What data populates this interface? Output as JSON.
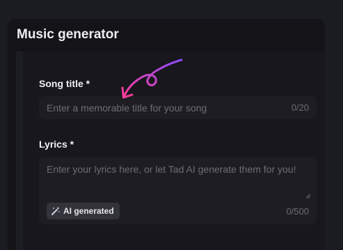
{
  "panel": {
    "title": "Music generator"
  },
  "song_title": {
    "label": "Song title *",
    "value": "",
    "placeholder": "Enter a memorable title for your song",
    "counter": "0/20"
  },
  "lyrics": {
    "label": "Lyrics *",
    "value": "",
    "placeholder": "Enter your lyrics here, or let Tad AI generate them for you!",
    "counter": "0/500",
    "ai_button_label": "AI generated",
    "ai_button_icon": "magic-wand-icon"
  },
  "decoration": {
    "arrow_icon": "curly-arrow-icon",
    "arrow_colors": [
      "#8a4dff",
      "#ff3d9a"
    ]
  },
  "colors": {
    "background": "#1b1b22",
    "panel": "#131318",
    "input": "#1d1d23",
    "badge": "#33333b"
  }
}
